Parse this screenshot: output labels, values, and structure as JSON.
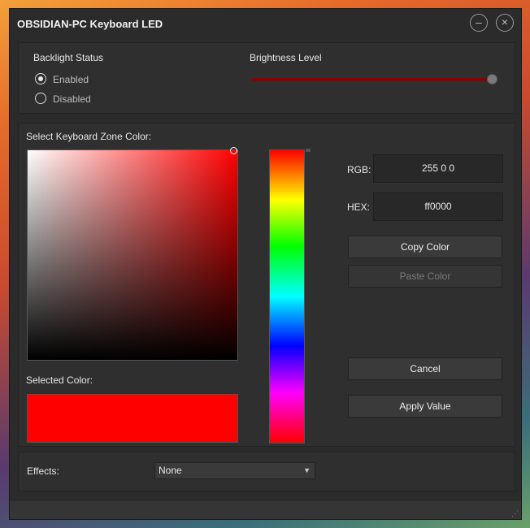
{
  "window": {
    "title": "OBSIDIAN-PC Keyboard LED",
    "minimize_icon": "minus-circle-icon",
    "close_icon": "close-circle-icon"
  },
  "backlight": {
    "label": "Backlight Status",
    "options": [
      {
        "label": "Enabled",
        "selected": true
      },
      {
        "label": "Disabled",
        "selected": false
      }
    ]
  },
  "brightness": {
    "label": "Brightness Level",
    "value_fraction": 1.0,
    "track_color": "#8b0000"
  },
  "color_picker": {
    "zone_label": "Select Keyboard Zone Color:",
    "selected_label": "Selected Color:",
    "selected_color": "#ff0000",
    "rgb_label": "RGB:",
    "rgb_value": "255 0 0",
    "hex_label": "HEX:",
    "hex_value": "ff0000"
  },
  "buttons": {
    "copy": "Copy Color",
    "paste": "Paste Color",
    "cancel": "Cancel",
    "apply": "Apply Value"
  },
  "effects": {
    "label": "Effects:",
    "selected": "None"
  }
}
